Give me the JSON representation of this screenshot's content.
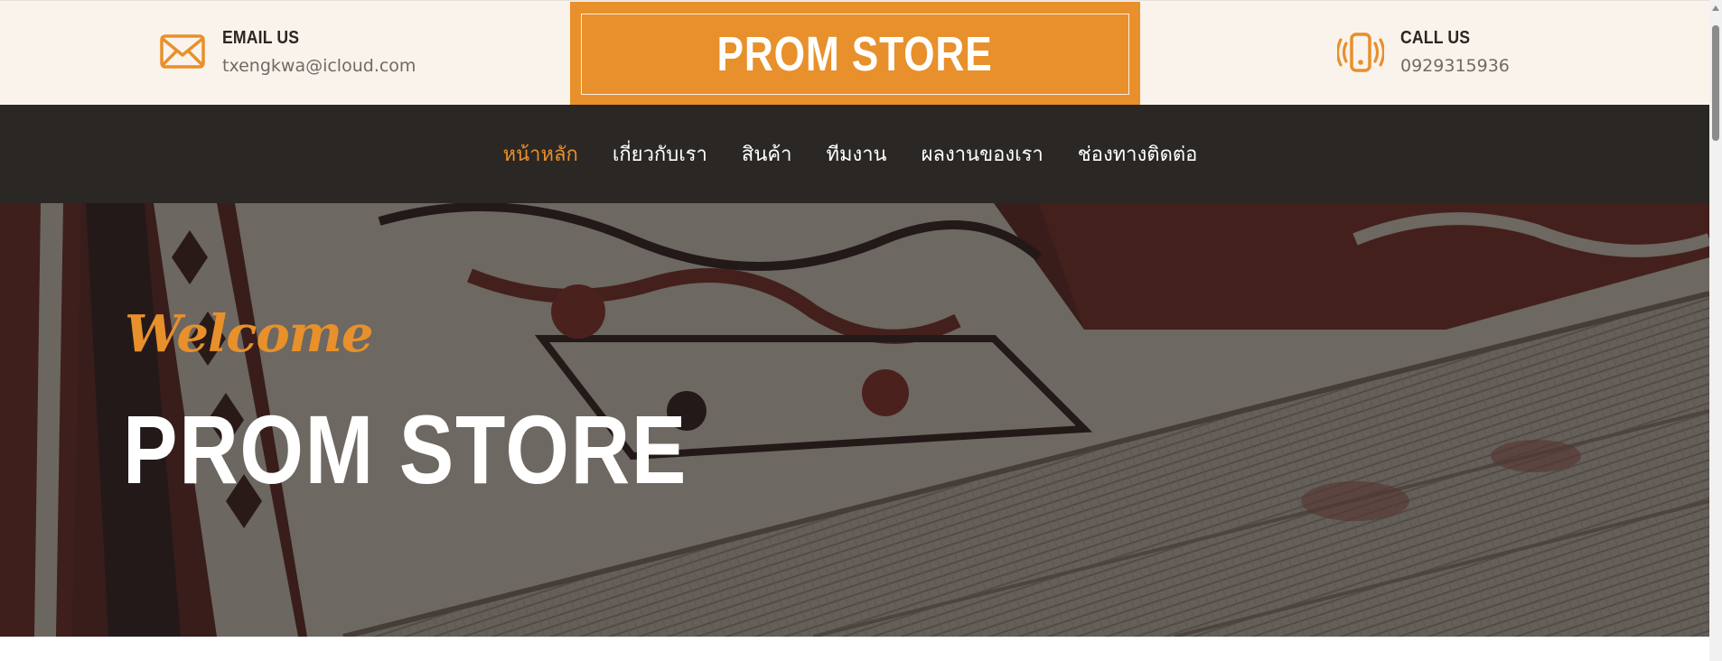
{
  "header": {
    "email": {
      "title": "EMAIL US",
      "value": "txengkwa@icloud.com",
      "icon": "envelope-icon"
    },
    "logo": "PROM STORE",
    "phone": {
      "title": "CALL US",
      "value": "0929315936",
      "icon": "vibrating-phone-icon"
    }
  },
  "nav": {
    "items": [
      {
        "label": "หน้าหลัก",
        "active": true
      },
      {
        "label": "เกี่ยวกับเรา",
        "active": false
      },
      {
        "label": "สินค้า",
        "active": false
      },
      {
        "label": "ทีมงาน",
        "active": false
      },
      {
        "label": "ผลงานของเรา",
        "active": false
      },
      {
        "label": "ช่องทางติดต่อ",
        "active": false
      }
    ]
  },
  "hero": {
    "welcome": "Welcome",
    "title": "PROM STORE",
    "background": "carpet-photo"
  },
  "colors": {
    "accent": "#e8902b",
    "nav_bg": "#2b2724",
    "header_bg": "#faf3ec"
  }
}
